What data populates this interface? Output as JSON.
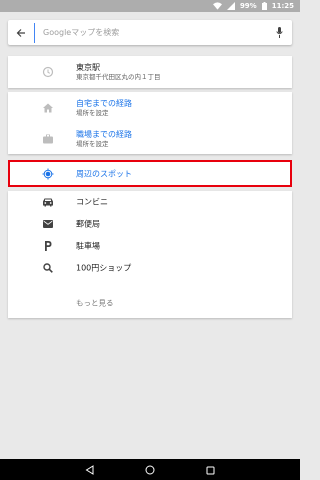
{
  "status_bar": {
    "battery": "99%",
    "time": "11:25"
  },
  "search": {
    "placeholder": "Googleマップを検索"
  },
  "recent": {
    "title": "東京駅",
    "subtitle": "東京都千代田区丸の内１丁目"
  },
  "routes": [
    {
      "title": "自宅までの経路",
      "subtitle": "場所を設定"
    },
    {
      "title": "職場までの経路",
      "subtitle": "場所を設定"
    }
  ],
  "nearby": {
    "label": "周辺のスポット"
  },
  "categories": [
    {
      "label": "コンビニ",
      "icon": "car-icon"
    },
    {
      "label": "郵便局",
      "icon": "mail-icon"
    },
    {
      "label": "駐車場",
      "icon": "parking-icon"
    },
    {
      "label": "100円ショップ",
      "icon": "search-icon"
    }
  ],
  "more": {
    "label": "もっと見る"
  },
  "colors": {
    "link_blue": "#1a73e8",
    "highlight_red": "#e8000d",
    "icon_gray": "#757575"
  }
}
